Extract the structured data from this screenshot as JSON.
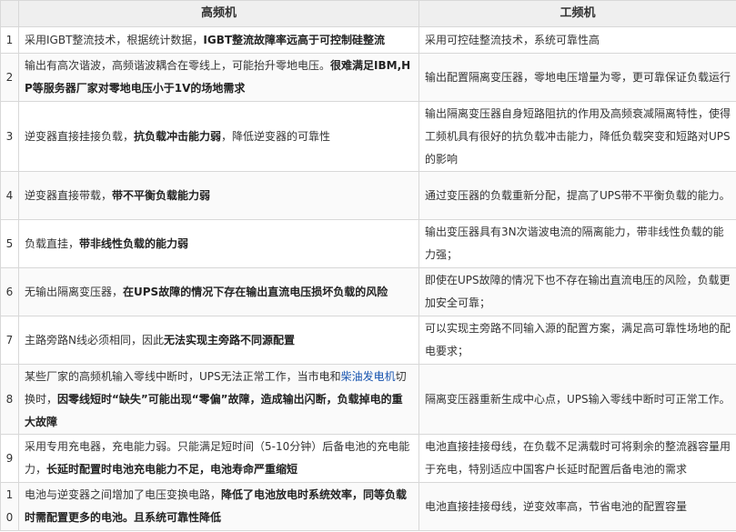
{
  "header": {
    "index": "",
    "col_high_freq": "高频机",
    "col_low_freq": "工频机"
  },
  "rows": [
    {
      "index": "1",
      "hf": [
        {
          "t": "采用IGBT整流技术，根据统计数据，",
          "b": false
        },
        {
          "t": "IGBT整流故障率远高于可控制硅整流",
          "b": true
        }
      ],
      "lf": [
        {
          "t": "采用可控硅整流技术，系统可靠性高",
          "b": false
        }
      ]
    },
    {
      "index": "2",
      "hf": [
        {
          "t": "输出有高次谐波，高频谐波耦合在零线上，可能抬升零地电压。",
          "b": false
        },
        {
          "t": "很难满足IBM,HP等服务器厂家对零地电压小于1V的场地需求",
          "b": true
        }
      ],
      "lf": [
        {
          "t": "输出配置隔离变压器，零地电压增量为零，更可靠保证负载运行",
          "b": false
        }
      ]
    },
    {
      "index": "3",
      "hf": [
        {
          "t": "逆变器直接挂接负载，",
          "b": false
        },
        {
          "t": "抗负载冲击能力弱",
          "b": true
        },
        {
          "t": "，降低逆变器的可靠性",
          "b": false
        }
      ],
      "lf": [
        {
          "t": "输出隔离变压器自身短路阻抗的作用及高频衰减隔离特性，使得工频机具有很好的抗负载冲击能力，降低负载突变和短路对UPS的影响",
          "b": false
        }
      ]
    },
    {
      "index": "4",
      "hf": [
        {
          "t": "逆变器直接带载，",
          "b": false
        },
        {
          "t": "带不平衡负载能力弱",
          "b": true
        }
      ],
      "lf": [
        {
          "t": "通过变压器的负载重新分配，提高了UPS带不平衡负载的能力。",
          "b": false
        }
      ]
    },
    {
      "index": "5",
      "hf": [
        {
          "t": "负载直挂，",
          "b": false
        },
        {
          "t": "带非线性负载的能力弱",
          "b": true
        }
      ],
      "lf": [
        {
          "t": "输出变压器具有3N次谐波电流的隔离能力，带非线性负载的能力强；",
          "b": false
        }
      ]
    },
    {
      "index": "6",
      "hf": [
        {
          "t": "无输出隔离变压器，",
          "b": false
        },
        {
          "t": "在UPS故障的情况下存在输出直流电压损坏负载的风险",
          "b": true
        }
      ],
      "lf": [
        {
          "t": "即使在UPS故障的情况下也不存在输出直流电压的风险，负载更加安全可靠；",
          "b": false
        }
      ]
    },
    {
      "index": "7",
      "hf": [
        {
          "t": "主路旁路N线必须相同，因此",
          "b": false
        },
        {
          "t": "无法实现主旁路不同源配置",
          "b": true
        }
      ],
      "lf": [
        {
          "t": "可以实现主旁路不同输入源的配置方案，满足高可靠性场地的配电要求；",
          "b": false
        }
      ]
    },
    {
      "index": "8",
      "hf": [
        {
          "t": "某些厂家的高频机输入零线中断时，UPS无法正常工作，当市电和",
          "b": false
        },
        {
          "t": "柴油发电机",
          "b": false,
          "link": true
        },
        {
          "t": "切换时，",
          "b": false
        },
        {
          "t": "因零线短时“缺失”可能出现“零偏”故障，造成输出闪断，负载掉电的重大故障",
          "b": true
        }
      ],
      "lf": [
        {
          "t": "隔离变压器重新生成中心点，UPS输入零线中断时可正常工作。",
          "b": false
        }
      ]
    },
    {
      "index": "9",
      "hf": [
        {
          "t": "采用专用充电器，充电能力弱。只能满足短时间（5-10分钟）后备电池的充电能力，",
          "b": false
        },
        {
          "t": "长延时配置时电池充电能力不足，电池寿命严重缩短",
          "b": true
        }
      ],
      "lf": [
        {
          "t": "电池直接挂接母线，在负载不足满载时可将剩余的整流器容量用于充电，特别适应中国客户长延时配置后备电池的需求",
          "b": false
        }
      ]
    },
    {
      "index": "10",
      "hf": [
        {
          "t": "电池与逆变器之间增加了电压变换电路，",
          "b": false
        },
        {
          "t": "降低了电池放电时系统效率，同等负载时需配置更多的电池。且系统可靠性降低",
          "b": true
        }
      ],
      "lf": [
        {
          "t": "电池直接挂接母线，逆变效率高，节省电池的配置容量",
          "b": false
        }
      ]
    }
  ]
}
